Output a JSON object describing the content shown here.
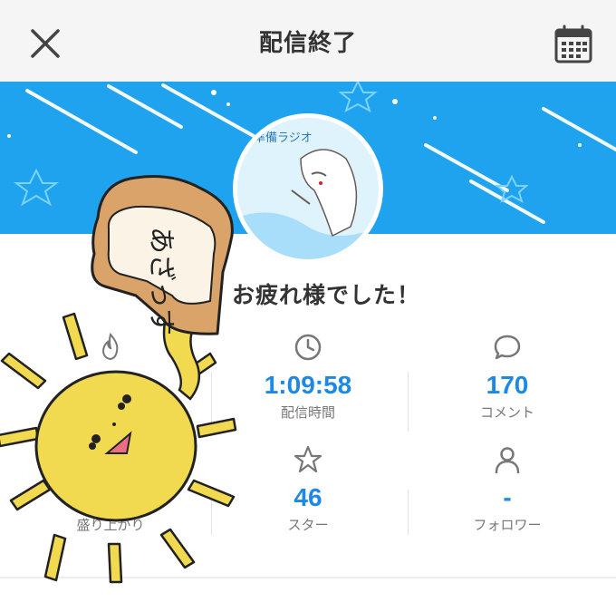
{
  "header": {
    "title": "配信終了"
  },
  "banner": {
    "color": "#1fa3ef"
  },
  "avatar": {
    "text": "準備ラジオ"
  },
  "message": "お疲れ様でした！",
  "stats": {
    "excitement": {
      "label": "盛り上がり"
    },
    "duration": {
      "value": "1:09:58",
      "label": "配信時間"
    },
    "comments": {
      "value": "170",
      "label": "コメント"
    },
    "stars": {
      "value": "46",
      "label": "スター"
    },
    "followers": {
      "value": "-",
      "label": "フォロワー"
    }
  },
  "sticker": {
    "text": "あざっす"
  },
  "colors": {
    "accent": "#1e88e5",
    "banner": "#1fa3ef",
    "sun": "#f2da50"
  }
}
